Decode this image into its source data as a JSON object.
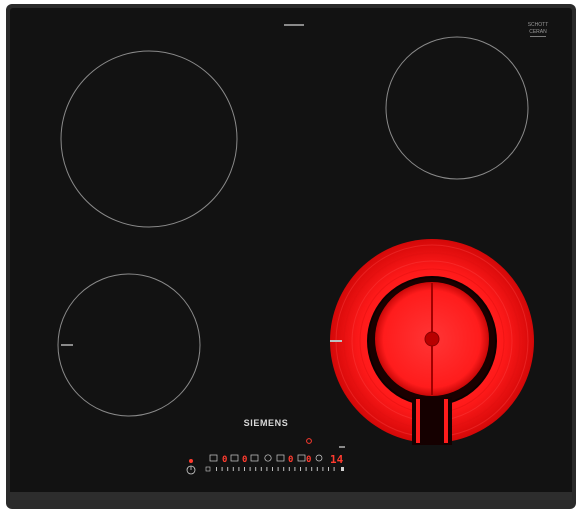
{
  "product": {
    "brand": "SIEMENS",
    "badge_lines": [
      "SCHOTT",
      "CERAN"
    ],
    "appliance": "ceramic glass hob with four cooking zones"
  },
  "zones": [
    {
      "id": "front-left",
      "heating": false
    },
    {
      "id": "back-left",
      "heating": false
    },
    {
      "id": "back-right",
      "heating": false
    },
    {
      "id": "front-right",
      "heating": true,
      "type": "dual-circuit"
    }
  ],
  "controls": {
    "power_level_display": "14",
    "zone_displays": [
      "0",
      "0",
      "0",
      "0"
    ],
    "icons": [
      "power-icon",
      "timer-icon",
      "zone-selector-icon",
      "lock-icon"
    ]
  },
  "colors": {
    "glass": "#111111",
    "frame": "#2a2a2a",
    "zone_outline": "#8a8a8a",
    "heating_red": "#ff1a1a",
    "indicator_red": "#ff3b2f",
    "print_white": "#d8d8d8"
  }
}
